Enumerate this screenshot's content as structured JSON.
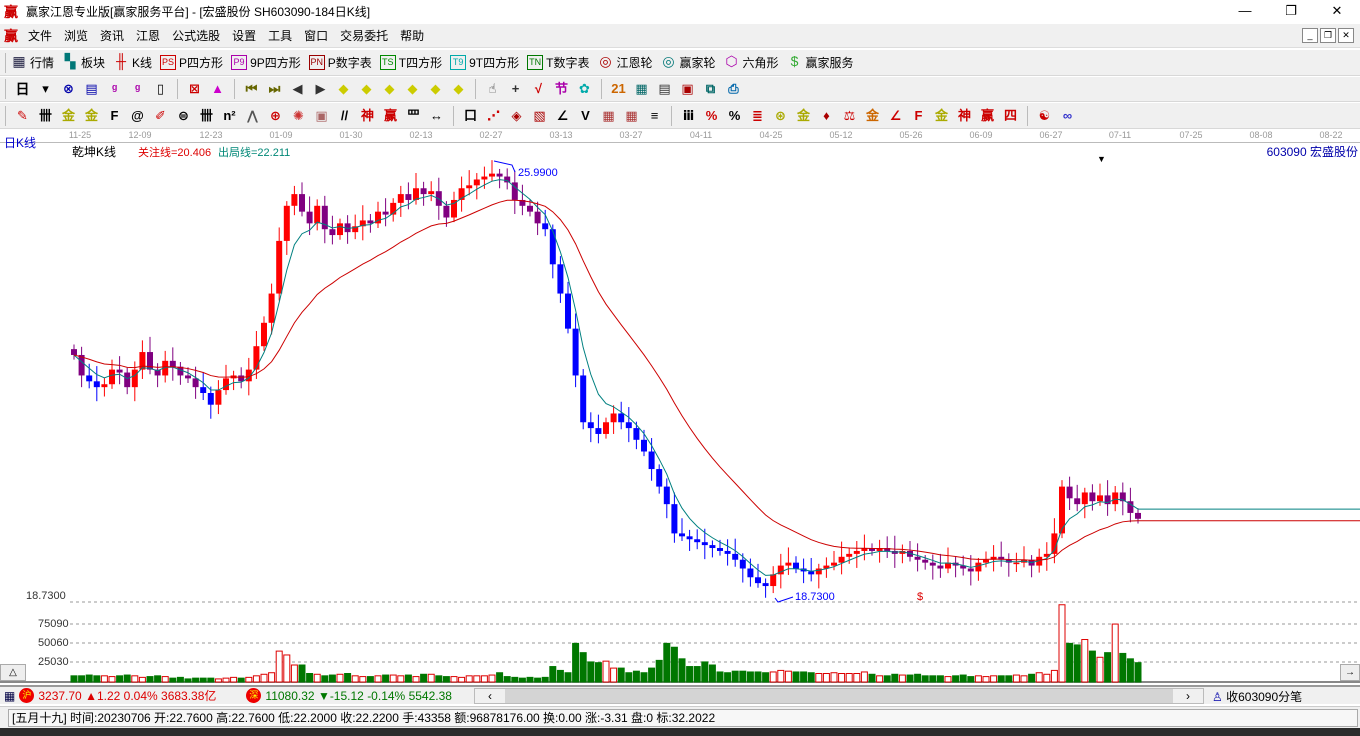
{
  "window": {
    "title": "赢家江恩专业版[赢家服务平台] - [宏盛股份  SH603090-184日K线]",
    "logo": "赢",
    "minimize": "—",
    "restore": "❐",
    "close": "✕"
  },
  "menu": {
    "logo": "赢",
    "items": [
      "文件",
      "浏览",
      "资讯",
      "江恩",
      "公式选股",
      "设置",
      "工具",
      "窗口",
      "交易委托",
      "帮助"
    ],
    "mdi": [
      "_",
      "❐",
      "✕"
    ]
  },
  "toolbar1": [
    {
      "icon": "table-icon",
      "glyph": "▦",
      "label": "行情",
      "color": "#224"
    },
    {
      "icon": "blocks-icon",
      "glyph": "▚",
      "label": "板块",
      "color": "#077"
    },
    {
      "icon": "kline-icon",
      "glyph": "╫",
      "label": "K线",
      "color": "#c00"
    },
    {
      "icon": "ps-icon",
      "glyph": "PS",
      "label": "P四方形",
      "color": "#c00"
    },
    {
      "icon": "p9-icon",
      "glyph": "P9",
      "label": "9P四方形",
      "color": "#a0a"
    },
    {
      "icon": "pn-icon",
      "glyph": "PN",
      "label": "P数字表",
      "color": "#900"
    },
    {
      "icon": "ts-icon",
      "glyph": "TS",
      "label": "T四方形",
      "color": "#080"
    },
    {
      "icon": "t9-icon",
      "glyph": "T9",
      "label": "9T四方形",
      "color": "#0aa"
    },
    {
      "icon": "tn-icon",
      "glyph": "TN",
      "label": "T数字表",
      "color": "#070"
    },
    {
      "icon": "gann-wheel-icon",
      "glyph": "◎",
      "label": "江恩轮",
      "color": "#a00"
    },
    {
      "icon": "winner-wheel-icon",
      "glyph": "◎",
      "label": "赢家轮",
      "color": "#077"
    },
    {
      "icon": "hexagon-icon",
      "glyph": "⬡",
      "label": "六角形",
      "color": "#a0a"
    },
    {
      "icon": "dollar-icon",
      "glyph": "$",
      "label": "赢家服务",
      "color": "#3a3"
    }
  ],
  "toolbar2": {
    "period": "日",
    "icons": [
      [
        "period-dropdown-icon",
        "▾",
        "#000"
      ],
      [
        "indicator-icon",
        "⊗",
        "#00a"
      ],
      [
        "note-icon",
        "▤",
        "#00a"
      ],
      [
        "chart3-icon",
        "ᵍ",
        "#a0a"
      ],
      [
        "chart9-icon",
        "ᵍ",
        "#a0a"
      ],
      [
        "candle-dropdown-icon",
        "▯",
        "#000"
      ],
      [
        "sep"
      ],
      [
        "draw-icon",
        "⊠",
        "#c00"
      ],
      [
        "color-icon",
        "▲",
        "#c0c"
      ],
      [
        "sep"
      ],
      [
        "first-icon",
        "⏮",
        "#660"
      ],
      [
        "last-icon",
        "⏭",
        "#660"
      ],
      [
        "left-icon",
        "◀",
        "#333"
      ],
      [
        "right-icon",
        "▶",
        "#333"
      ],
      [
        "move-left-icon",
        "◆",
        "#cc0"
      ],
      [
        "move-right-icon",
        "◆",
        "#cc0"
      ],
      [
        "zoom-h-icon",
        "◆",
        "#cc0"
      ],
      [
        "shrink-h-icon",
        "◆",
        "#cc0"
      ],
      [
        "shrink-v-icon",
        "◆",
        "#cc0"
      ],
      [
        "zoom-v-icon",
        "◆",
        "#cc0"
      ],
      [
        "sep"
      ],
      [
        "hand-icon",
        "☝",
        "#333"
      ],
      [
        "crosshair-icon",
        "+",
        "#333"
      ],
      [
        "trend-icon",
        "√",
        "#c00"
      ],
      [
        "mark-icon",
        "节",
        "#a0a"
      ],
      [
        "cycle-icon",
        "✿",
        "#0aa"
      ],
      [
        "sep"
      ],
      [
        "calendar-icon",
        "21",
        "#c60"
      ],
      [
        "calculator-icon",
        "▦",
        "#066"
      ],
      [
        "list-icon",
        "▤",
        "#333"
      ],
      [
        "save-icon",
        "▣",
        "#a00"
      ],
      [
        "network-icon",
        "⧉",
        "#066"
      ],
      [
        "print-icon",
        "⎙",
        "#06a"
      ]
    ]
  },
  "toolbar3": {
    "icons": [
      [
        "pen-icon",
        "✎",
        "#c00"
      ],
      [
        "grid-icon",
        "卌",
        "#000"
      ],
      [
        "gold1-icon",
        "金",
        "#aa0"
      ],
      [
        "gold2-icon",
        "金",
        "#aa0"
      ],
      [
        "line-f-icon",
        "F",
        "#000"
      ],
      [
        "spiral-icon",
        "@",
        "#000"
      ],
      [
        "brush-icon",
        "✐",
        "#c00"
      ],
      [
        "circle-grid-icon",
        "⊜",
        "#000"
      ],
      [
        "hash-icon",
        "卌",
        "#000"
      ],
      [
        "n2-icon",
        "n²",
        "#000"
      ],
      [
        "fan-icon",
        "⋀",
        "#555"
      ],
      [
        "target-icon",
        "⊕",
        "#c00"
      ],
      [
        "radar-icon",
        "✺",
        "#c33"
      ],
      [
        "square-grid-icon",
        "▣",
        "#a66"
      ],
      [
        "lines-icon",
        "//",
        "#000"
      ],
      [
        "shen-icon",
        "神",
        "#c00"
      ],
      [
        "ying-icon",
        "赢",
        "#c00"
      ],
      [
        "comb-icon",
        "罒",
        "#000"
      ],
      [
        "range-icon",
        "↔",
        "#000"
      ],
      [
        "sep"
      ],
      [
        "box-icon",
        "口",
        "#000"
      ],
      [
        "fan-lines-icon",
        "⋰",
        "#c00"
      ],
      [
        "arc-icon",
        "◈",
        "#a00"
      ],
      [
        "gann-square-icon",
        "▧",
        "#a00"
      ],
      [
        "angle-icon",
        "∠",
        "#000"
      ],
      [
        "v-icon",
        "V",
        "#000"
      ],
      [
        "mesh-icon",
        "▦",
        "#a33"
      ],
      [
        "mesh2-icon",
        "▦",
        "#a33"
      ],
      [
        "parallel-icon",
        "≡",
        "#000"
      ],
      [
        "sep"
      ],
      [
        "ruler-icon",
        "ⅲ",
        "#000"
      ],
      [
        "percent-line-icon",
        "%",
        "#c00"
      ],
      [
        "percent-icon",
        "%",
        "#000"
      ],
      [
        "pct-lines-icon",
        "≣",
        "#c00"
      ],
      [
        "gold-circle-icon",
        "⊛",
        "#aa0"
      ],
      [
        "gold-lines-icon",
        "金",
        "#aa0"
      ],
      [
        "rocket-icon",
        "♦",
        "#a00"
      ],
      [
        "fa-icon",
        "⚖",
        "#c00"
      ],
      [
        "gold-bar-icon",
        "金",
        "#c60"
      ],
      [
        "angle-lines-icon",
        "∠",
        "#c00"
      ],
      [
        "f-angle-icon",
        "F",
        "#c00"
      ],
      [
        "gold-angle-icon",
        "金",
        "#aa0"
      ],
      [
        "shen-angle-icon",
        "神",
        "#c00"
      ],
      [
        "ying-angle-icon",
        "赢",
        "#c00"
      ],
      [
        "four-angle-icon",
        "四",
        "#c00"
      ],
      [
        "sep"
      ],
      [
        "taiji-icon",
        "☯",
        "#c00"
      ],
      [
        "infinity-icon",
        "∞",
        "#33c"
      ]
    ]
  },
  "axis": {
    "dates": [
      "11-25",
      "12-09",
      "12-23",
      "01-09",
      "01-30",
      "02-13",
      "02-27",
      "03-13",
      "03-27",
      "04-11",
      "04-25",
      "05-12",
      "05-26",
      "06-09",
      "06-27",
      "07-11",
      "07-25",
      "08-08",
      "08-22"
    ]
  },
  "labels": {
    "period": "日K线",
    "indicator": "乾坤K线",
    "attention_line": "关注线=20.406",
    "exit_line": "出局线=22.211",
    "stock": "603090  宏盛股份",
    "high_mark": "25.9900",
    "low_mark": "18.7300",
    "low_axis": "18.7300",
    "dollar": "$",
    "marker": "▼"
  },
  "volume_axis": [
    "75090",
    "50060",
    "25030"
  ],
  "buttons": {
    "up": "△",
    "right": "→"
  },
  "index_bar": {
    "sh": {
      "badge": "沪",
      "value": "3237.70",
      "change": "▲1.22",
      "pct": "0.04%",
      "amount": "3683.38亿"
    },
    "sz": {
      "badge": "深",
      "value": "11080.32",
      "change": "▼-15.12",
      "pct": "-0.14%",
      "amount": "5542.38"
    },
    "scroll_left": "‹",
    "scroll_right": "›",
    "tick_label": "收603090分笔"
  },
  "status": "[五月十九] 时间:20230706 开:22.7600 高:22.7600 低:22.2000 收:22.2200 手:43358 额:96878176.00 换:0.00 涨:-3.31 盘:0 标:32.2022",
  "colors": {
    "up": "#ff0000",
    "down": "#0000ff",
    "neutral": "#800080",
    "vol_down": "#007700",
    "ma_short": "#008080",
    "ma_long": "#cc0000"
  },
  "chart_data": {
    "type": "candlestick",
    "title": "宏盛股份 SH603090 日K线",
    "price_range": [
      18.73,
      25.99
    ],
    "close": [
      22.85,
      22.5,
      22.4,
      22.3,
      22.35,
      22.6,
      22.55,
      22.3,
      22.6,
      22.9,
      22.6,
      22.5,
      22.75,
      22.65,
      22.5,
      22.45,
      22.3,
      22.2,
      22.0,
      22.25,
      22.45,
      22.5,
      22.4,
      22.6,
      23.0,
      23.4,
      23.9,
      24.8,
      25.4,
      25.6,
      25.3,
      25.1,
      25.4,
      25.0,
      24.9,
      25.1,
      24.95,
      25.05,
      25.15,
      25.1,
      25.3,
      25.25,
      25.45,
      25.6,
      25.5,
      25.7,
      25.6,
      25.65,
      25.4,
      25.2,
      25.5,
      25.7,
      25.75,
      25.85,
      25.9,
      25.95,
      25.9,
      25.8,
      25.5,
      25.4,
      25.3,
      25.1,
      25.0,
      24.4,
      23.9,
      23.3,
      22.5,
      21.7,
      21.6,
      21.5,
      21.7,
      21.85,
      21.7,
      21.6,
      21.4,
      21.2,
      20.9,
      20.6,
      20.3,
      19.8,
      19.75,
      19.7,
      19.65,
      19.6,
      19.55,
      19.5,
      19.45,
      19.35,
      19.2,
      19.05,
      18.95,
      18.9,
      19.1,
      19.25,
      19.3,
      19.2,
      19.15,
      19.1,
      19.2,
      19.25,
      19.3,
      19.4,
      19.45,
      19.5,
      19.55,
      19.5,
      19.55,
      19.5,
      19.45,
      19.5,
      19.4,
      19.35,
      19.3,
      19.25,
      19.2,
      19.3,
      19.25,
      19.2,
      19.15,
      19.3,
      19.35,
      19.4,
      19.35,
      19.3,
      19.3,
      19.35,
      19.25,
      19.4,
      19.45,
      19.8,
      20.6,
      20.4,
      20.3,
      20.5,
      20.35,
      20.45,
      20.3,
      20.5,
      20.35,
      20.15,
      20.05
    ],
    "volume": [
      8000,
      8000,
      9000,
      8000,
      8000,
      7000,
      8000,
      9000,
      8000,
      6000,
      7000,
      8000,
      7000,
      5000,
      6000,
      4000,
      5000,
      5000,
      5000,
      4000,
      5000,
      6000,
      5000,
      6000,
      8000,
      10000,
      12000,
      40000,
      35000,
      22000,
      22000,
      11000,
      10000,
      8000,
      9000,
      10000,
      11000,
      8000,
      7000,
      7000,
      8000,
      9000,
      9000,
      8000,
      9000,
      7000,
      10000,
      10000,
      8000,
      7000,
      7000,
      6000,
      8000,
      8000,
      8000,
      9000,
      12000,
      7000,
      6000,
      5000,
      6000,
      5000,
      6000,
      20000,
      15000,
      12000,
      50000,
      38000,
      26000,
      25000,
      27000,
      18000,
      18000,
      12000,
      14000,
      12000,
      18000,
      28000,
      50000,
      45000,
      30000,
      20000,
      20000,
      26000,
      22000,
      13000,
      12000,
      14000,
      14000,
      13000,
      13000,
      12000,
      13000,
      15000,
      14000,
      13000,
      13000,
      12000,
      11000,
      11000,
      12000,
      11000,
      11000,
      11000,
      13000,
      10000,
      8000,
      8000,
      10000,
      9000,
      9000,
      10000,
      8000,
      8000,
      8000,
      7000,
      8000,
      9000,
      7000,
      8000,
      7000,
      8000,
      8000,
      8000,
      9000,
      8000,
      10000,
      12000,
      10000,
      15000,
      100000,
      50000,
      48000,
      55000,
      40000,
      32000,
      38000,
      75000,
      37000,
      30000,
      25000
    ],
    "ma_short_period": 5,
    "ma_long_period": 20,
    "volume_ticks": [
      25030,
      50060,
      75090
    ]
  }
}
